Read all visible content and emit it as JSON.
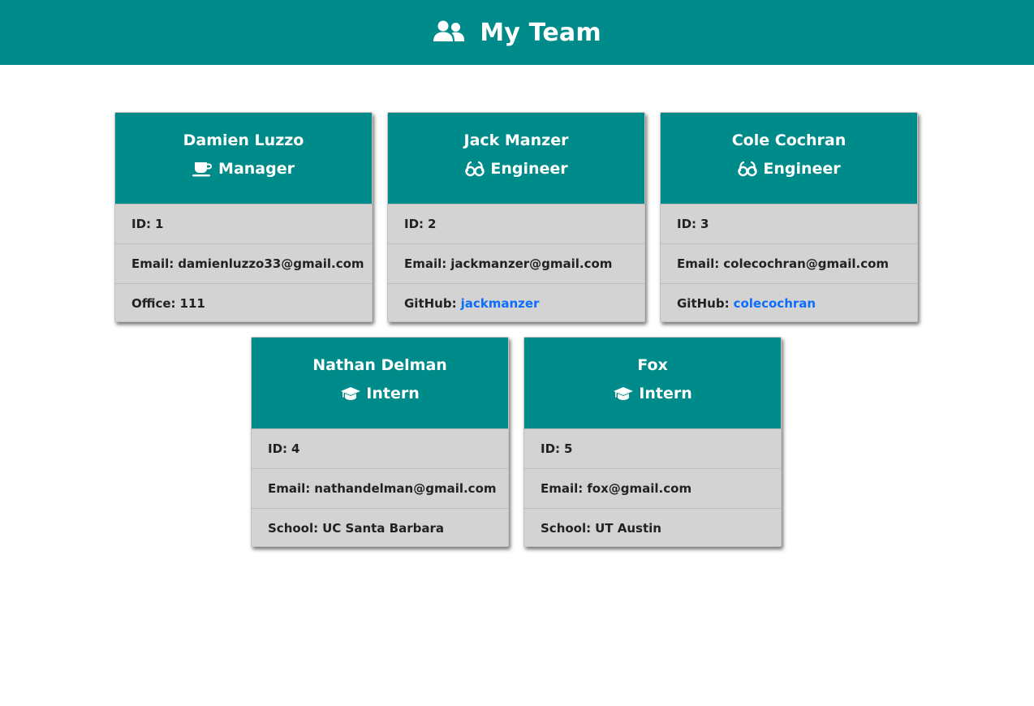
{
  "header": {
    "title": "My Team",
    "icon": "users-icon",
    "background": "#008b8b"
  },
  "colors": {
    "accent": "#008b8b",
    "card_body": "#d3d3d3",
    "link": "#0d6efd"
  },
  "employees": [
    {
      "name": "Damien Luzzo",
      "role": "Manager",
      "role_icon": "coffee-mug-icon",
      "id_label": "ID:",
      "id": "1",
      "email_label": "Email:",
      "email": "damienluzzo33@gmail.com",
      "extra_label": "Office:",
      "extra": "111"
    },
    {
      "name": "Jack Manzer",
      "role": "Engineer",
      "role_icon": "glasses-icon",
      "id_label": "ID:",
      "id": "2",
      "email_label": "Email:",
      "email": "jackmanzer@gmail.com",
      "extra_label": "GitHub:",
      "extra": "jackmanzer"
    },
    {
      "name": "Cole Cochran",
      "role": "Engineer",
      "role_icon": "glasses-icon",
      "id_label": "ID:",
      "id": "3",
      "email_label": "Email:",
      "email": "colecochran@gmail.com",
      "extra_label": "GitHub:",
      "extra": "colecochran"
    },
    {
      "name": "Nathan Delman",
      "role": "Intern",
      "role_icon": "graduation-cap-icon",
      "id_label": "ID:",
      "id": "4",
      "email_label": "Email:",
      "email": "nathandelman@gmail.com",
      "extra_label": "School:",
      "extra": "UC Santa Barbara"
    },
    {
      "name": "Fox",
      "role": "Intern",
      "role_icon": "graduation-cap-icon",
      "id_label": "ID:",
      "id": "5",
      "email_label": "Email:",
      "email": "fox@gmail.com",
      "extra_label": "School:",
      "extra": "UT Austin"
    }
  ]
}
